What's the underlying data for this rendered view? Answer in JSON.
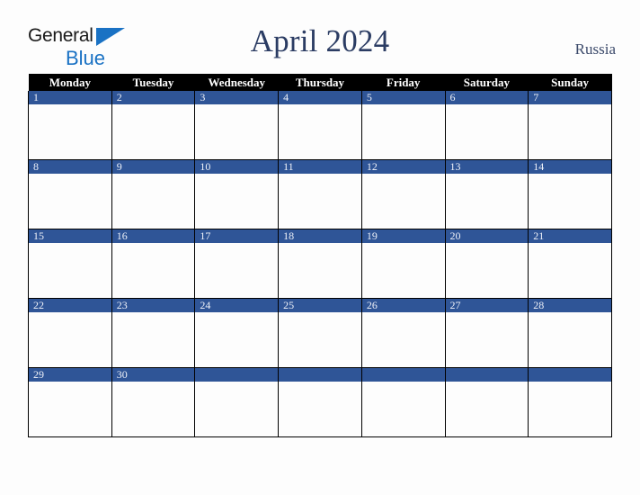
{
  "brand": {
    "name_part1": "General",
    "name_part2": "Blue",
    "triangle_icon": "triangle-icon",
    "colors": {
      "dark": "#1a1a1a",
      "blue": "#1a72c4"
    }
  },
  "header": {
    "title": "April 2024",
    "region": "Russia",
    "title_color": "#2b3c63"
  },
  "calendar": {
    "month": "April",
    "year": "2024",
    "first_day_of_week": "Monday",
    "colors": {
      "header_bg": "#000000",
      "header_text": "#ffffff",
      "daynum_bg": "#2f5597",
      "daynum_text": "#eef1f8",
      "cell_bg": "#fdfdfd",
      "border": "#000000",
      "page_bg": "#fdfdfd"
    },
    "weekday_headers": [
      "Monday",
      "Tuesday",
      "Wednesday",
      "Thursday",
      "Friday",
      "Saturday",
      "Sunday"
    ],
    "weeks": [
      {
        "days": [
          {
            "num": "1",
            "note": ""
          },
          {
            "num": "2",
            "note": ""
          },
          {
            "num": "3",
            "note": ""
          },
          {
            "num": "4",
            "note": ""
          },
          {
            "num": "5",
            "note": ""
          },
          {
            "num": "6",
            "note": ""
          },
          {
            "num": "7",
            "note": ""
          }
        ]
      },
      {
        "days": [
          {
            "num": "8",
            "note": ""
          },
          {
            "num": "9",
            "note": ""
          },
          {
            "num": "10",
            "note": ""
          },
          {
            "num": "11",
            "note": ""
          },
          {
            "num": "12",
            "note": ""
          },
          {
            "num": "13",
            "note": ""
          },
          {
            "num": "14",
            "note": ""
          }
        ]
      },
      {
        "days": [
          {
            "num": "15",
            "note": ""
          },
          {
            "num": "16",
            "note": ""
          },
          {
            "num": "17",
            "note": ""
          },
          {
            "num": "18",
            "note": ""
          },
          {
            "num": "19",
            "note": ""
          },
          {
            "num": "20",
            "note": ""
          },
          {
            "num": "21",
            "note": ""
          }
        ]
      },
      {
        "days": [
          {
            "num": "22",
            "note": ""
          },
          {
            "num": "23",
            "note": ""
          },
          {
            "num": "24",
            "note": ""
          },
          {
            "num": "25",
            "note": ""
          },
          {
            "num": "26",
            "note": ""
          },
          {
            "num": "27",
            "note": ""
          },
          {
            "num": "28",
            "note": ""
          }
        ]
      },
      {
        "days": [
          {
            "num": "29",
            "note": ""
          },
          {
            "num": "30",
            "note": ""
          },
          {
            "num": "",
            "note": ""
          },
          {
            "num": "",
            "note": ""
          },
          {
            "num": "",
            "note": ""
          },
          {
            "num": "",
            "note": ""
          },
          {
            "num": "",
            "note": ""
          }
        ]
      }
    ]
  }
}
